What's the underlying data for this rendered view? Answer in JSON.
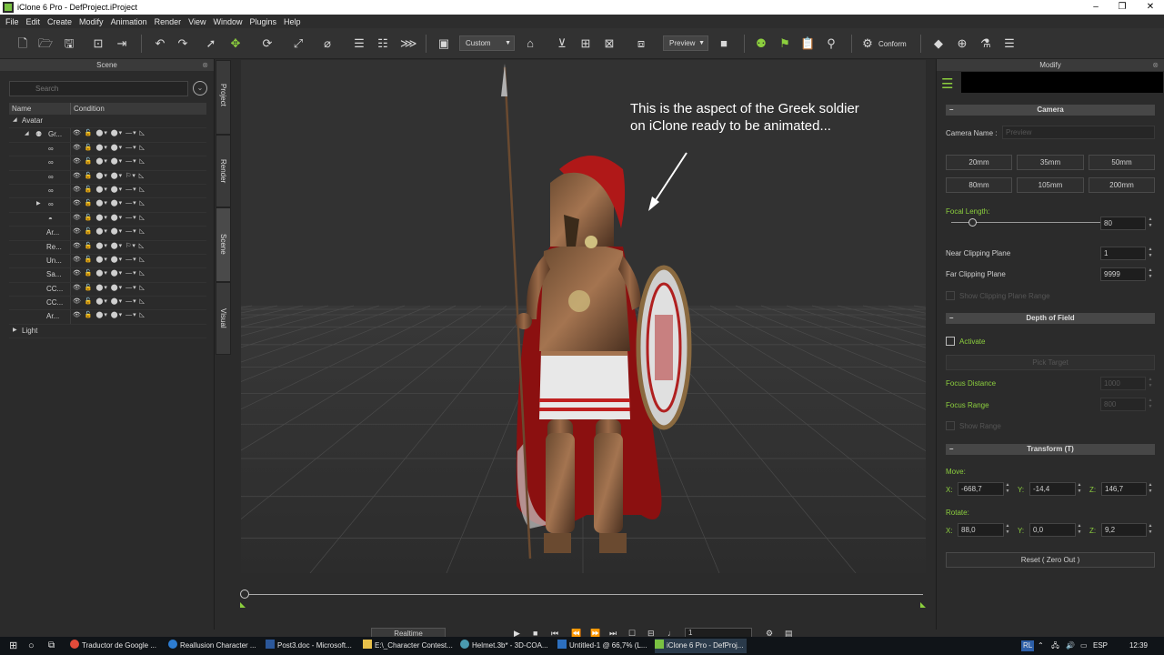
{
  "window": {
    "title": "iClone 6 Pro - DefProject.iProject"
  },
  "menu": [
    "File",
    "Edit",
    "Create",
    "Modify",
    "Animation",
    "Render",
    "View",
    "Window",
    "Plugins",
    "Help"
  ],
  "toolbar": {
    "view_dropdown": "Custom",
    "preview_dropdown": "Preview",
    "conform_label": "Conform"
  },
  "scene_panel": {
    "title": "Scene",
    "search_placeholder": "Search",
    "col_name": "Name",
    "col_condition": "Condition",
    "groups": {
      "avatar": "Avatar",
      "light": "Light"
    },
    "rows": [
      "Gr...",
      "",
      "",
      "",
      "",
      "",
      "",
      "Ar...",
      "Re...",
      "Un...",
      "Sa...",
      "CC...",
      "CC...",
      "Ar..."
    ]
  },
  "side_tabs": [
    "Project",
    "Render",
    "Scene",
    "Visual"
  ],
  "viewport": {
    "annotation_line1": "This is the aspect of the Greek soldier",
    "annotation_line2": "on iClone ready to be animated..."
  },
  "timeline": {
    "realtime_label": "Realtime",
    "frame": "1"
  },
  "modify_panel": {
    "title": "Modify",
    "camera": {
      "header": "Camera",
      "name_label": "Camera Name :",
      "name_value": "Preview",
      "lens_buttons": [
        "20mm",
        "35mm",
        "50mm",
        "80mm",
        "105mm",
        "200mm"
      ],
      "focal_label": "Focal Length:",
      "focal_value": "80",
      "focal_fraction": 0.14,
      "near_label": "Near Clipping Plane",
      "near_value": "1",
      "far_label": "Far Clipping Plane",
      "far_value": "9999",
      "show_range_label": "Show Clipping Plane Range"
    },
    "dof": {
      "header": "Depth of Field",
      "activate_label": "Activate",
      "pick_target": "Pick Target",
      "focus_distance_label": "Focus Distance",
      "focus_distance_value": "1000",
      "focus_range_label": "Focus Range",
      "focus_range_value": "800",
      "show_range_label": "Show Range"
    },
    "transform": {
      "header": "Transform  (T)",
      "move_label": "Move:",
      "move": {
        "x": "-668,7",
        "y": "-14,4",
        "z": "146,7"
      },
      "rotate_label": "Rotate:",
      "rotate": {
        "x": "88,0",
        "y": "0,0",
        "z": "9,2"
      },
      "axis_x": "X:",
      "axis_y": "Y:",
      "axis_z": "Z:",
      "reset_label": "Reset ( Zero Out )"
    }
  },
  "taskbar": {
    "items": [
      "Traductor de Google ...",
      "Reallusion Character ...",
      "Post3.doc - Microsoft...",
      "E:\\_Character Contest...",
      "Helmet.3b* - 3D-COA...",
      "Untitled-1 @ 66,7% (L...",
      "iClone 6 Pro - DefProj..."
    ],
    "lang": "ESP",
    "tray_badge": "RL",
    "time": "12:39"
  }
}
